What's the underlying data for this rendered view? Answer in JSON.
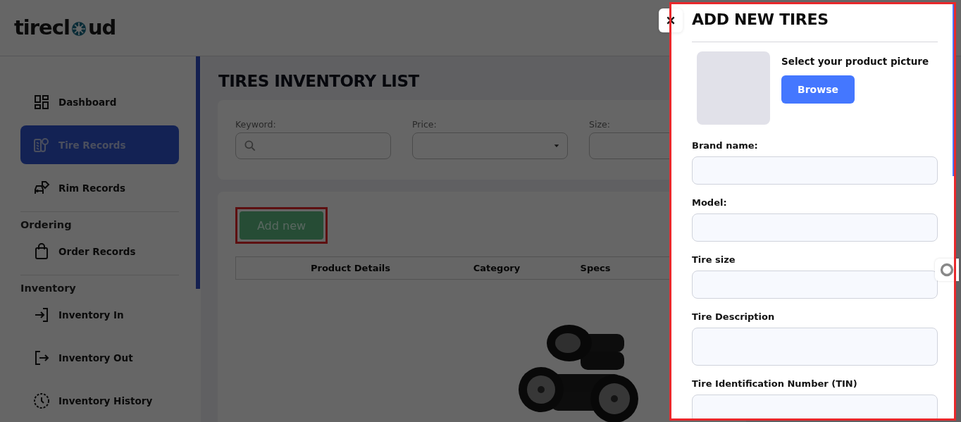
{
  "header": {
    "logo_start": "tirecl",
    "logo_end": "ud"
  },
  "sidebar": {
    "sections": [
      {
        "items": [
          {
            "label": "Dashboard",
            "kind": "dashboard",
            "selected": false
          },
          {
            "label": "Tire Records",
            "kind": "tire",
            "selected": true
          },
          {
            "label": "Rim Records",
            "kind": "car",
            "selected": false
          }
        ]
      },
      {
        "heading": "Ordering",
        "items": [
          {
            "label": "Order Records",
            "kind": "bag",
            "selected": false
          }
        ]
      },
      {
        "heading": "Inventory",
        "items": [
          {
            "label": "Inventory In",
            "kind": "in",
            "selected": false
          },
          {
            "label": "Inventory Out",
            "kind": "out",
            "selected": false
          },
          {
            "label": "Inventory History",
            "kind": "clock",
            "selected": false
          }
        ]
      }
    ]
  },
  "main": {
    "title": "TIRES INVENTORY LIST",
    "filters": [
      {
        "label": "Keyword:",
        "kind": "search"
      },
      {
        "label": "Price:",
        "kind": "select"
      },
      {
        "label": "Size:",
        "kind": "text"
      }
    ],
    "add_button": {
      "label": "Add new",
      "highlighted": true
    },
    "table": {
      "columns": [
        "Product Details",
        "Category",
        "Specs"
      ]
    }
  },
  "drawer": {
    "title": "ADD NEW TIRES",
    "highlighted": true,
    "picture_prompt": "Select your product picture",
    "browse_button": "Browse",
    "fields": [
      {
        "label": "Brand name:",
        "kind": "input"
      },
      {
        "label": "Model:",
        "kind": "input"
      },
      {
        "label": "Tire size",
        "kind": "input"
      },
      {
        "label": "Tire Description",
        "kind": "textarea"
      },
      {
        "label": "Tire Identification Number (TIN)",
        "kind": "input"
      }
    ]
  }
}
